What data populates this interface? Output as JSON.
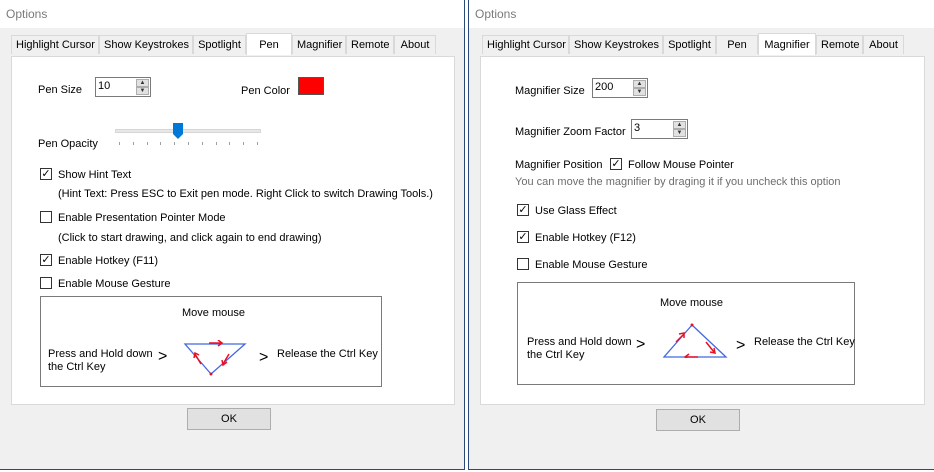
{
  "window_title": "Options",
  "tabs": [
    "Highlight Cursor",
    "Show Keystrokes",
    "Spotlight",
    "Pen",
    "Magnifier",
    "Remote",
    "About"
  ],
  "ok_label": "OK",
  "pen": {
    "size_label": "Pen Size",
    "size_value": "10",
    "color_label": "Pen Color",
    "color_value": "#ff0000",
    "opacity_label": "Pen Opacity",
    "opacity_level": 0.43,
    "show_hint_label": "Show Hint Text",
    "show_hint_checked": true,
    "hint_text": "(Hint Text: Press ESC to Exit pen mode.  Right Click to switch Drawing Tools.)",
    "presentation_label": "Enable Presentation Pointer Mode",
    "presentation_checked": false,
    "presentation_note": "(Click to start drawing, and click again to end drawing)",
    "hotkey_label": "Enable Hotkey (F11)",
    "hotkey_checked": true,
    "gesture_label": "Enable Mouse Gesture",
    "gesture_checked": false
  },
  "magnifier": {
    "size_label": "Magnifier Size",
    "size_value": "200",
    "zoom_label": "Magnifier Zoom Factor",
    "zoom_value": "3",
    "position_label": "Magnifier Position",
    "follow_label": "Follow Mouse Pointer",
    "follow_checked": true,
    "note": "You can move the magnifier by draging it if you uncheck this option",
    "glass_label": "Use Glass Effect",
    "glass_checked": true,
    "hotkey_label": "Enable Hotkey (F12)",
    "hotkey_checked": true,
    "gesture_label": "Enable Mouse Gesture",
    "gesture_checked": false
  },
  "gesture": {
    "move_mouse": "Move mouse",
    "press_hold": "Press and Hold down",
    "ctrl_key": "the Ctrl Key",
    "arrow": ">",
    "release": "Release the Ctrl Key"
  },
  "colors": {
    "accent": "#0078d7",
    "gesture_line": "#4169e1",
    "gesture_arrow": "#e81123"
  }
}
